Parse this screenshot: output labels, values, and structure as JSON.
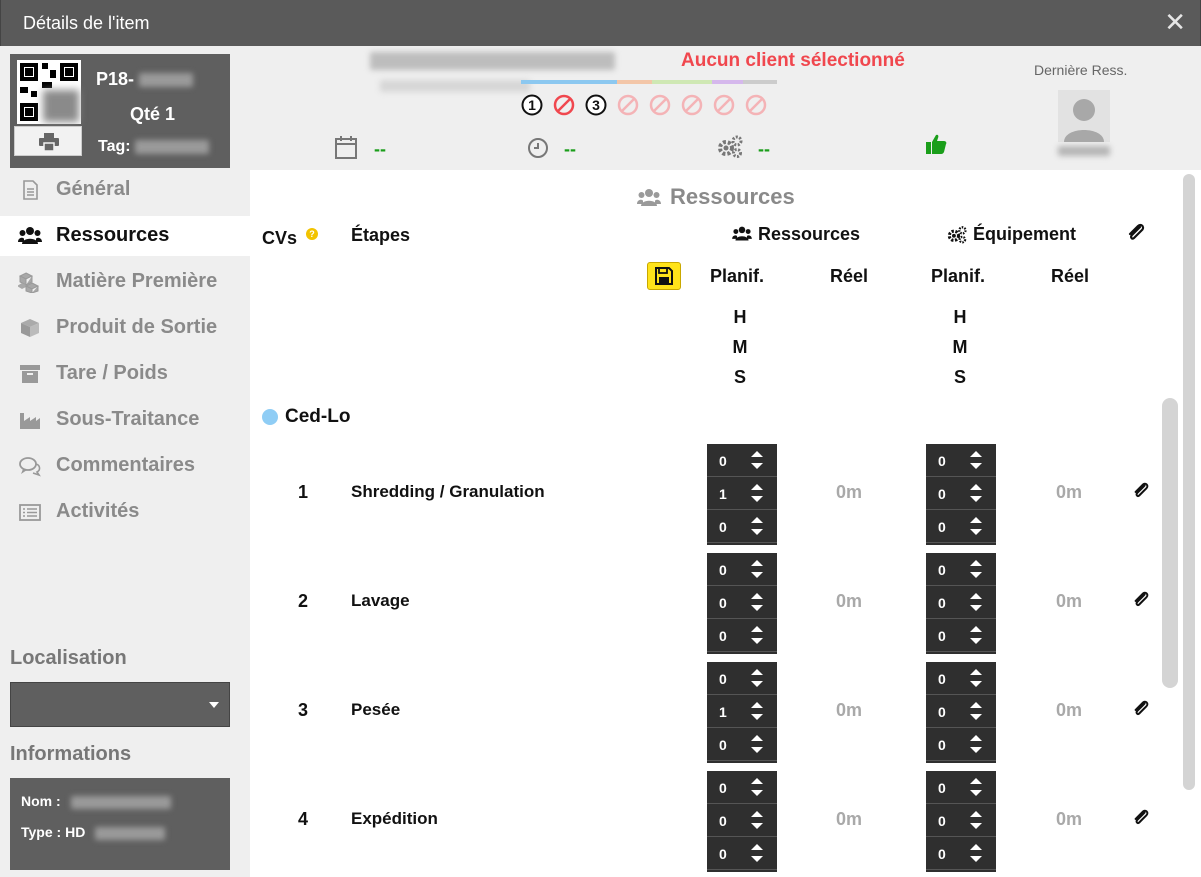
{
  "window": {
    "title": "Détails de l'item",
    "close_glyph": "✕"
  },
  "item": {
    "code_prefix": "P18-",
    "qty_label": "Qté 1",
    "tag_label": "Tag:"
  },
  "nav": [
    {
      "label": "Général",
      "icon": "document-icon",
      "active": false
    },
    {
      "label": "Ressources",
      "icon": "users-icon",
      "active": true
    },
    {
      "label": "Matière Première",
      "icon": "cubes-icon",
      "active": false
    },
    {
      "label": "Produit de Sortie",
      "icon": "cube-icon",
      "active": false
    },
    {
      "label": "Tare / Poids",
      "icon": "archive-icon",
      "active": false
    },
    {
      "label": "Sous-Traitance",
      "icon": "industry-icon",
      "active": false
    },
    {
      "label": "Commentaires",
      "icon": "comments-icon",
      "active": false
    },
    {
      "label": "Activités",
      "icon": "list-icon",
      "active": false
    }
  ],
  "sidebar": {
    "location_heading": "Localisation",
    "info_heading": "Informations",
    "name_label": "Nom :",
    "type_label": "Type : HD"
  },
  "header": {
    "client_status": "Aucun client sélectionné",
    "steps": [
      {
        "label": "1",
        "state": "done"
      },
      {
        "label": "",
        "state": "blocked"
      },
      {
        "label": "3",
        "state": "done"
      },
      {
        "label": "",
        "state": "blocked-faded"
      },
      {
        "label": "",
        "state": "blocked-faded"
      },
      {
        "label": "",
        "state": "blocked-faded"
      },
      {
        "label": "",
        "state": "blocked-faded"
      },
      {
        "label": "",
        "state": "blocked-faded"
      }
    ],
    "progress_colors": [
      "#8cc8f0",
      "#f3c6a8",
      "#cfe8b4",
      "#d5b8ec",
      "#cccccc"
    ],
    "date_value": "--",
    "time_value": "--",
    "equipment_value": "--",
    "last_resource_label": "Dernière Ress.",
    "accent_green": "#1a9e1a",
    "alert_red": "#f0474e"
  },
  "main": {
    "section_title": "Ressources",
    "col_cvs": "CVs",
    "col_steps": "Étapes",
    "col_resources": "Ressources",
    "col_equipment": "Équipement",
    "planned": "Planif.",
    "real": "Réel",
    "units": [
      "H",
      "M",
      "S"
    ],
    "group_name": "Ced-Lo",
    "rows": [
      {
        "num": "1",
        "name": "Shredding / Granulation",
        "res": [
          "0",
          "1",
          "0"
        ],
        "res_real": "0m",
        "eq": [
          "0",
          "0",
          "0"
        ],
        "eq_real": "0m"
      },
      {
        "num": "2",
        "name": "Lavage",
        "res": [
          "0",
          "0",
          "0"
        ],
        "res_real": "0m",
        "eq": [
          "0",
          "0",
          "0"
        ],
        "eq_real": "0m"
      },
      {
        "num": "3",
        "name": "Pesée",
        "res": [
          "0",
          "1",
          "0"
        ],
        "res_real": "0m",
        "eq": [
          "0",
          "0",
          "0"
        ],
        "eq_real": "0m"
      },
      {
        "num": "4",
        "name": "Expédition",
        "res": [
          "0",
          "0",
          "0"
        ],
        "res_real": "0m",
        "eq": [
          "0",
          "0",
          "0"
        ],
        "eq_real": "0m"
      }
    ]
  }
}
